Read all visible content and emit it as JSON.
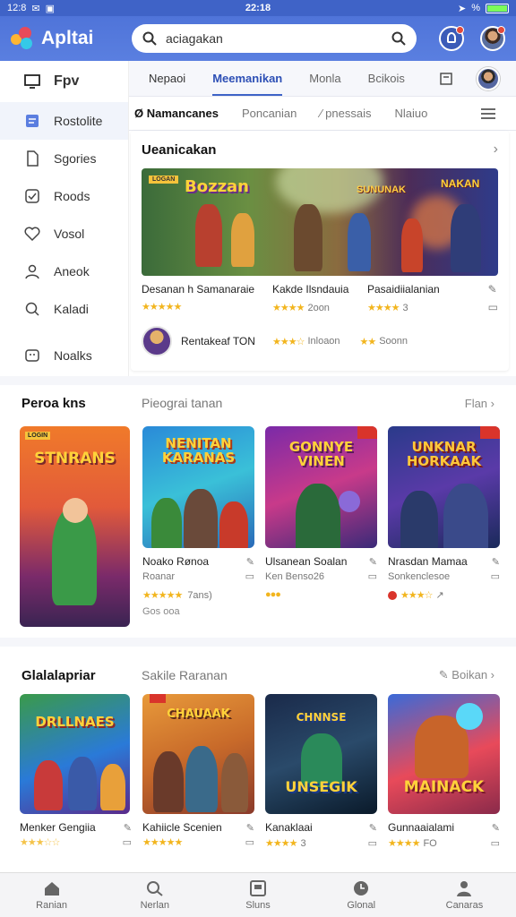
{
  "status": {
    "left": "12:8",
    "clock": "22:18",
    "signal": "%"
  },
  "header": {
    "app_name": "Apltai",
    "search_value": "aciagakan"
  },
  "sidebar": {
    "items": [
      {
        "label": "Fpv"
      },
      {
        "label": "Rostolite"
      },
      {
        "label": "Sgories"
      },
      {
        "label": "Roods"
      },
      {
        "label": "Vosol"
      },
      {
        "label": "Aneok"
      },
      {
        "label": "Kaladi"
      },
      {
        "label": "Noalks"
      }
    ]
  },
  "tabs": [
    {
      "label": "Nepaoi"
    },
    {
      "label": "Meemanikan"
    },
    {
      "label": "Monla"
    },
    {
      "label": "Bcikois"
    }
  ],
  "subtabs": [
    {
      "label": "Ø Namancanes"
    },
    {
      "label": "Poncanian"
    },
    {
      "label": "⁄ pnessais"
    },
    {
      "label": "Nlaiuo"
    }
  ],
  "featured": {
    "title": "Ueanicakan",
    "banner": {
      "tag": "LOGAN",
      "title_left": "Bozzan",
      "title_mid": "SUNUNAK",
      "title_right": "NAKAN"
    },
    "items": [
      {
        "name": "Desanan h Samanaraie",
        "rating": "★★★★★"
      },
      {
        "name": "Kakde Ilsndauia",
        "rating": "★★★★",
        "sub": "2oon"
      },
      {
        "name": "Pasaidiialanian",
        "rating": "★★★★",
        "sub": "3"
      }
    ],
    "review": {
      "name": "Rentakeaf TON",
      "rating_a": "★★★☆",
      "sub_a": "Inloaon",
      "rating_b": "★★",
      "sub_b": "Soonn"
    }
  },
  "section1": {
    "title": "Peroa kns",
    "middle": "Pieograi tanan",
    "right": "Flan",
    "cards": [
      {
        "art": "STNRANS",
        "tag": "LOGIN",
        "name": "",
        "sub": "",
        "rating": "",
        "extra": ""
      },
      {
        "art": "NENITAN KARANAS",
        "name": "Noako Rønoa",
        "sub": "Roanar",
        "rating": "★★★★★",
        "extra": "7ans)",
        "extra2": "Gos ooa"
      },
      {
        "art": "GONNYE VINEN",
        "name": "Ulsanean Soalan",
        "sub": "Ken Benso26",
        "rating": "●●●",
        "extra": ""
      },
      {
        "art": "UNKNAR HORKAAK",
        "name": "Nrasdan Mamaa",
        "sub": "Sonkenclesoe",
        "rating": "★★★☆",
        "extra": ""
      }
    ]
  },
  "section2": {
    "title": "Glalalapriar",
    "middle": "Sakile Raranan",
    "right": "Boikan",
    "cards": [
      {
        "art": "DRLLNAES",
        "name": "Menker Gengiia",
        "rating": "★★★☆☆",
        "sub": ""
      },
      {
        "art": "CHAUAAK",
        "name": "Kahiicle Scenien",
        "rating": "★★★★★",
        "sub": ""
      },
      {
        "art": "UNSEGIK",
        "name": "Kanaklaai",
        "rating": "★★★★",
        "sub": "3"
      },
      {
        "art": "MAINACK",
        "name": "Gunnaaialami",
        "rating": "★★★★",
        "sub": "FO"
      }
    ]
  },
  "bottom_nav": [
    {
      "label": "Ranian"
    },
    {
      "label": "Nerlan"
    },
    {
      "label": "Sluns"
    },
    {
      "label": "Glonal"
    },
    {
      "label": "Canaras"
    }
  ],
  "colors": {
    "brand": "#4f74d9",
    "accent": "#2d4fb5",
    "star": "#f2b51e"
  }
}
